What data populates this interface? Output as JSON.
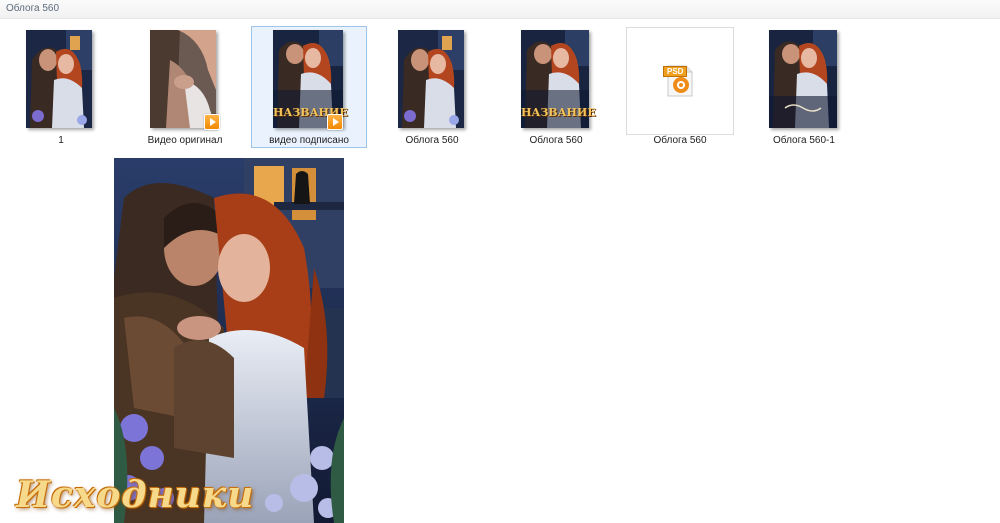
{
  "window": {
    "title": "Облога 560"
  },
  "files": [
    {
      "label": "1",
      "kind": "image"
    },
    {
      "label": "Видео оригинал",
      "kind": "video"
    },
    {
      "label": "видео подписано",
      "kind": "video",
      "selected": true,
      "overlay_title": "НАЗВАНИЕ"
    },
    {
      "label": "Облога  560",
      "kind": "image"
    },
    {
      "label": "Облога 560",
      "kind": "image",
      "overlay_title": "НАЗВАНИЕ"
    },
    {
      "label": "Облога 560",
      "kind": "psd",
      "badge": "PSD"
    },
    {
      "label": "Облога 560-1",
      "kind": "image"
    }
  ],
  "watermark": {
    "text": "Исходники",
    "color": "#f7d98b"
  },
  "colors": {
    "selection_border": "#9ec4ea",
    "selection_fill": "#eaf3fd",
    "play_badge": "#f28a00"
  }
}
